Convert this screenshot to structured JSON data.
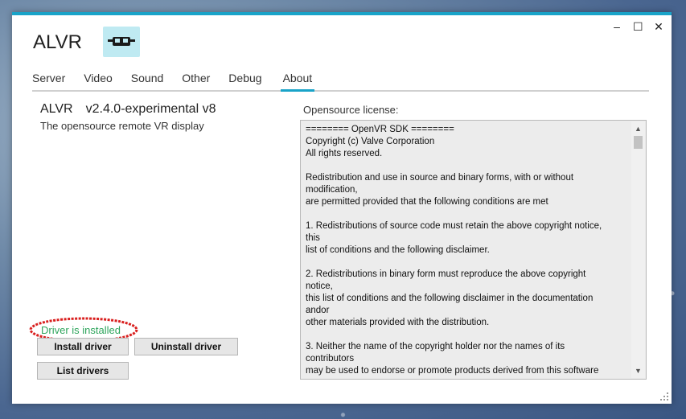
{
  "app": {
    "title": "ALVR",
    "logo_icon": "vr-headset-icon",
    "window_controls": {
      "minimize": "–",
      "maximize": "☐",
      "close": "✕"
    }
  },
  "tabs": [
    {
      "label": "Server"
    },
    {
      "label": "Video"
    },
    {
      "label": "Sound"
    },
    {
      "label": "Other"
    },
    {
      "label": "Debug"
    },
    {
      "label": "About",
      "active": true
    }
  ],
  "about": {
    "name": "ALVR",
    "version": "v2.4.0-experimental v8",
    "tagline": "The opensource remote VR display",
    "driver_status": "Driver is installed",
    "buttons": {
      "install": "Install driver",
      "uninstall": "Uninstall driver",
      "list": "List drivers"
    },
    "license_label": "Opensource license:",
    "license_text": "======== OpenVR SDK ========\nCopyright (c) Valve Corporation\nAll rights reserved.\n\nRedistribution and use in source and binary forms, with or without\nmodification,\nare permitted provided that the following conditions are met\n\n1. Redistributions of source code must retain the above copyright notice,\nthis\nlist of conditions and the following disclaimer.\n\n2. Redistributions in binary form must reproduce the above copyright\nnotice,\nthis list of conditions and the following disclaimer in the documentation\nandor\nother materials provided with the distribution.\n\n3. Neither the name of the copyright holder nor the names of its\ncontributors\nmay be used to endorse or promote products derived from this software"
  },
  "colors": {
    "accent": "#19a3c8",
    "status_ok": "#2ea55c",
    "annotation": "#d9201f",
    "logo_bg": "#bfeaf2"
  }
}
